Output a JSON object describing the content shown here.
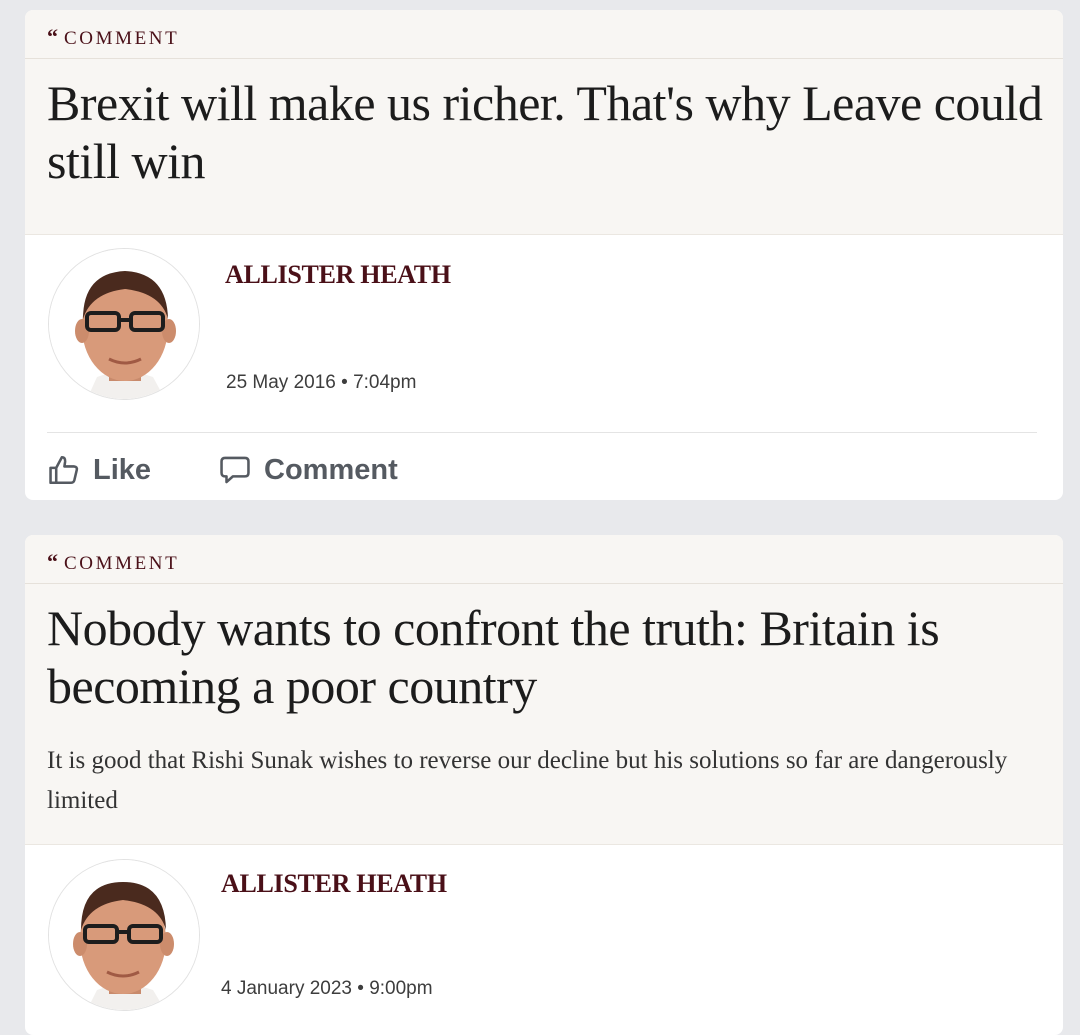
{
  "posts": [
    {
      "kicker": "COMMENT",
      "headline": "Brexit will make us richer. That's why Leave could still win",
      "author": "ALLISTER HEATH",
      "date": "25 May 2016 • 7:04pm",
      "actions": {
        "like": "Like",
        "comment": "Comment"
      }
    },
    {
      "kicker": "COMMENT",
      "headline": "Nobody wants to confront the truth: Britain is becoming a poor country",
      "standfirst": "It is good that Rishi Sunak wishes to reverse our decline but his solutions so far are dangerously limited",
      "author": "ALLISTER HEATH",
      "date": "4 January 2023 • 9:00pm"
    }
  ],
  "colors": {
    "kicker": "#4a1018",
    "author": "#4a1018",
    "header_bg": "#f8f6f3",
    "page_bg": "#e8e9ec"
  },
  "icons": {
    "quote": "quote-mark-icon",
    "like": "thumbs-up-icon",
    "comment": "speech-bubble-icon"
  }
}
